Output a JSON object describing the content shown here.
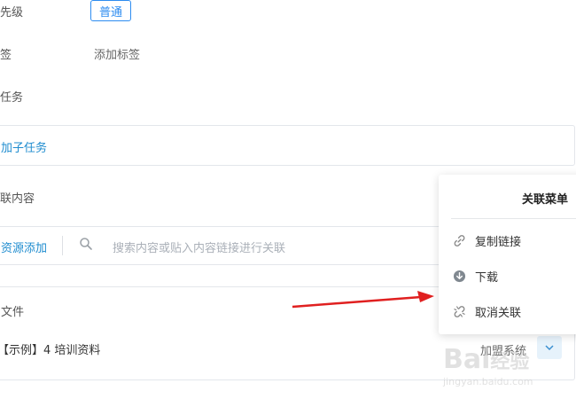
{
  "fields": {
    "priority_label": "先级",
    "priority_value": "普通",
    "tag_label": "签",
    "tag_placeholder": "添加标签",
    "subtask_label": "任务",
    "add_subtask": "加子任务",
    "related_label": "联内容",
    "resource_add": "资源添加",
    "search_placeholder": "搜索内容或贴入内容链接进行关联",
    "file_label": "文件",
    "file_name": "【示例】4 培训资料",
    "file_source": "加盟系统"
  },
  "menu": {
    "title": "关联菜单",
    "items": [
      {
        "label": "复制链接",
        "icon": "link-icon"
      },
      {
        "label": "下载",
        "icon": "download-icon"
      },
      {
        "label": "取消关联",
        "icon": "unlink-icon"
      }
    ]
  },
  "watermark": {
    "brand": "Bai",
    "brand_cn": "经验",
    "url": "jingyan.baidu.com"
  },
  "colors": {
    "accent": "#1f8ccf",
    "badge": "#2d8cf0",
    "arrow": "#e02020"
  }
}
